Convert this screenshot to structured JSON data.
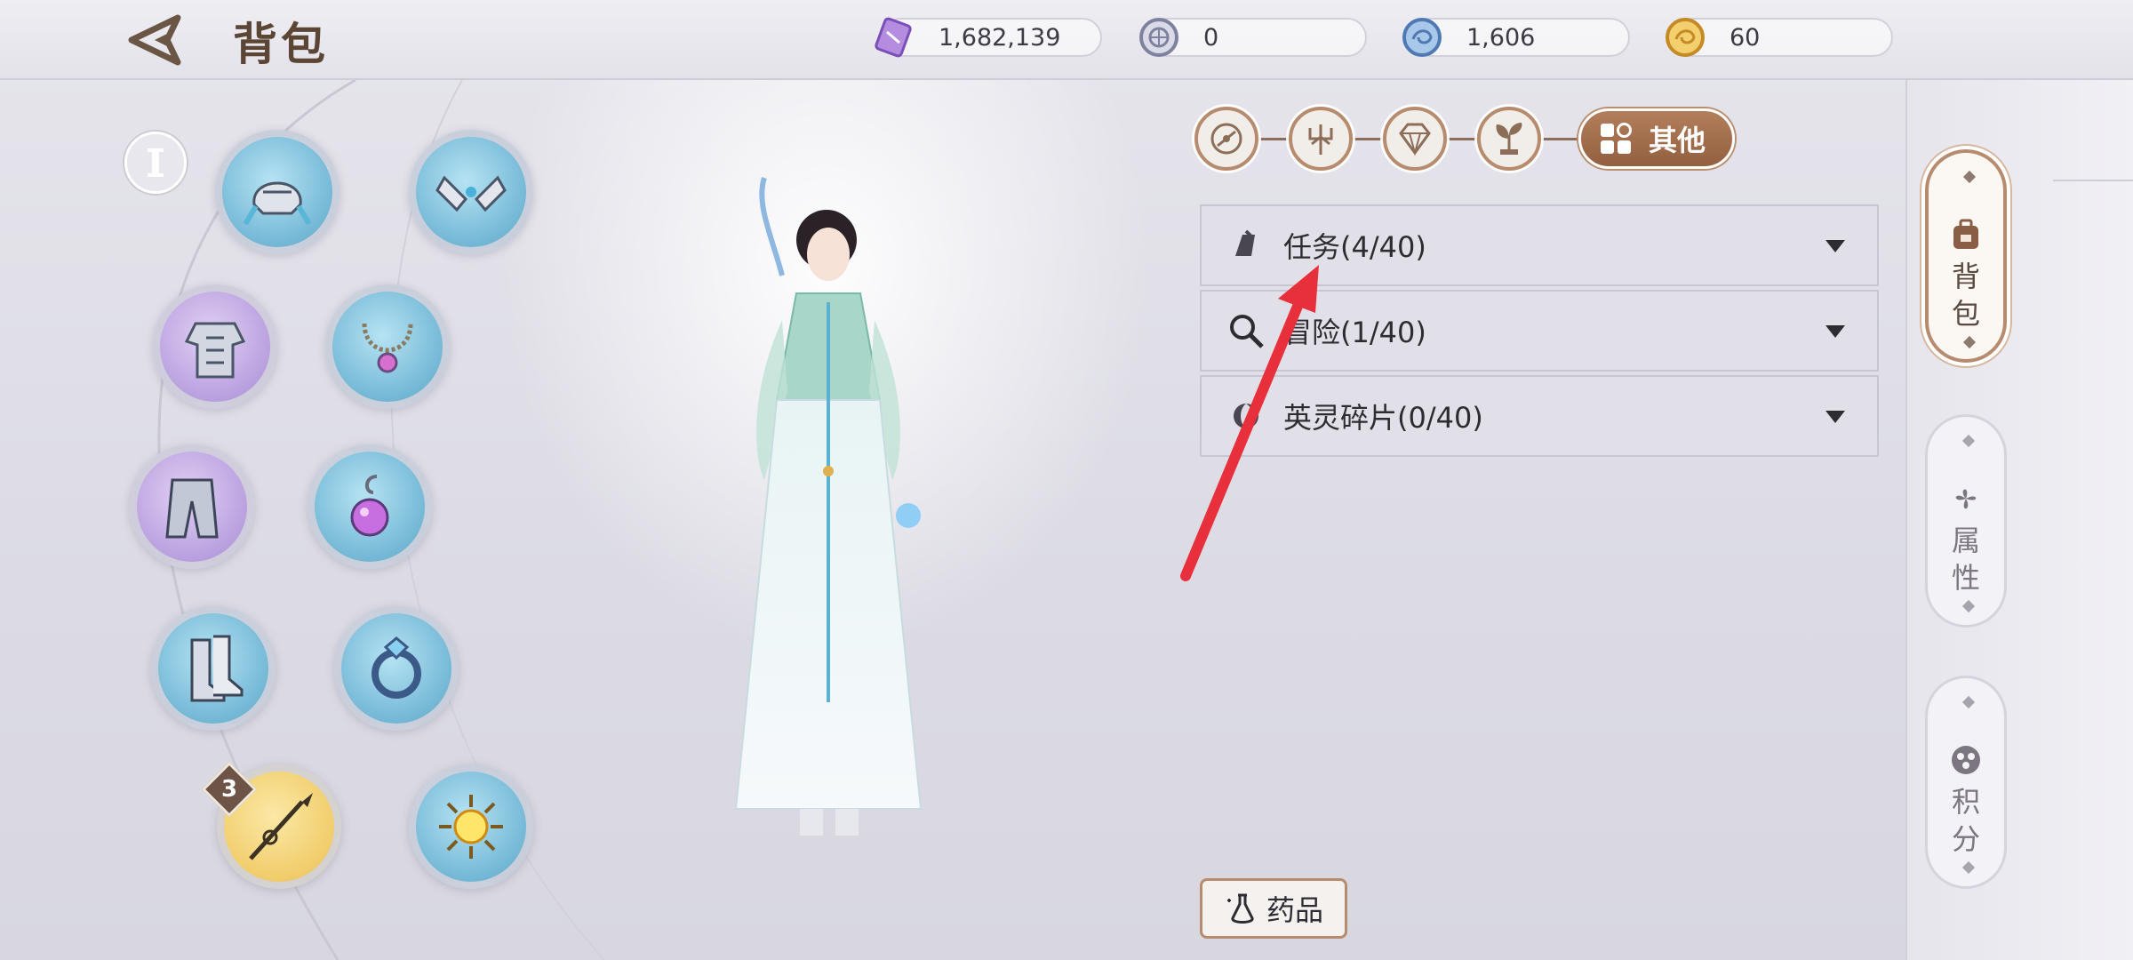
{
  "header": {
    "title": "背包",
    "currencies": [
      {
        "icon": "purple-crystal-icon",
        "value": "1,682,139"
      },
      {
        "icon": "silver-coin-icon",
        "value": "0"
      },
      {
        "icon": "blue-coin-icon",
        "value": "1,606"
      },
      {
        "icon": "gold-coin-icon",
        "value": "60"
      }
    ]
  },
  "equipment": {
    "weapon_badge": "3",
    "slots": [
      {
        "name": "helmet",
        "icon": "helmet-icon"
      },
      {
        "name": "gloves",
        "icon": "gloves-icon"
      },
      {
        "name": "armor",
        "icon": "chest-armor-icon"
      },
      {
        "name": "necklace",
        "icon": "necklace-icon"
      },
      {
        "name": "pants",
        "icon": "pants-icon"
      },
      {
        "name": "earring",
        "icon": "earring-icon"
      },
      {
        "name": "boots",
        "icon": "boots-icon"
      },
      {
        "name": "ring",
        "icon": "ring-icon"
      },
      {
        "name": "weapon",
        "icon": "spear-icon"
      },
      {
        "name": "orb",
        "icon": "sun-orb-icon"
      }
    ]
  },
  "category_tabs": {
    "icons": [
      "compass-icon",
      "trident-icon",
      "gem-icon",
      "sprout-icon"
    ],
    "active_label": "其他"
  },
  "category_list": [
    {
      "icon": "scroll-icon",
      "label": "任务(4/40)"
    },
    {
      "icon": "magnifier-icon",
      "label": "冒险(1/40)"
    },
    {
      "icon": "spirit-icon",
      "label": "英灵碎片(0/40)"
    }
  ],
  "medicine_button": {
    "label": "药品"
  },
  "side_tabs": [
    {
      "label": "背包",
      "active": true
    },
    {
      "label": "属性",
      "active": false
    },
    {
      "label": "积分",
      "active": false
    }
  ],
  "colors": {
    "accent_brown": "#b27e5c",
    "annotation_red": "#e8303c",
    "slot_blue": "#74b8d6",
    "slot_purple": "#b9a0df",
    "slot_gold": "#f1cd6b"
  }
}
